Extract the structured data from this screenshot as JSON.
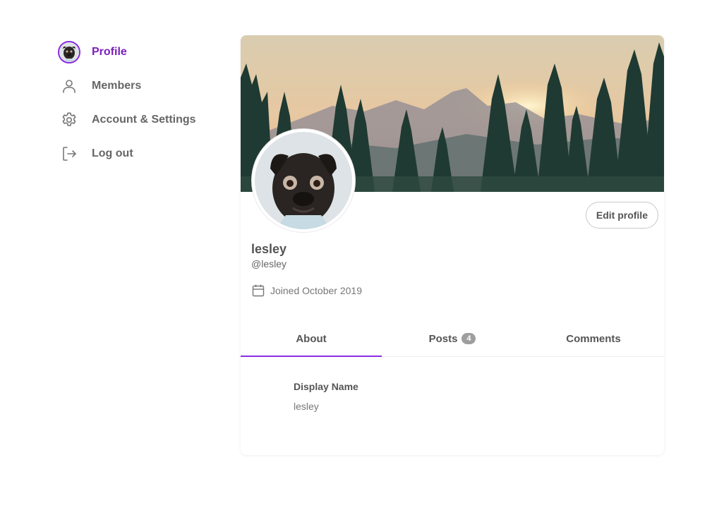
{
  "sidebar": {
    "items": [
      {
        "label": "Profile",
        "icon": "avatar",
        "active": true
      },
      {
        "label": "Members",
        "icon": "person-icon"
      },
      {
        "label": "Account & Settings",
        "icon": "gear-icon"
      },
      {
        "label": "Log out",
        "icon": "logout-icon"
      }
    ]
  },
  "profile": {
    "name": "lesley",
    "handle": "@lesley",
    "joined": "Joined October 2019",
    "edit_label": "Edit profile"
  },
  "tabs": [
    {
      "label": "About",
      "active": true
    },
    {
      "label": "Posts",
      "count": "4"
    },
    {
      "label": "Comments"
    }
  ],
  "about": {
    "fields": [
      {
        "label": "Display Name",
        "value": "lesley"
      }
    ]
  },
  "colors": {
    "accent": "#8a2be2",
    "active_text": "#7b1fbe",
    "text": "#555555",
    "badge": "#9e9e9e"
  }
}
